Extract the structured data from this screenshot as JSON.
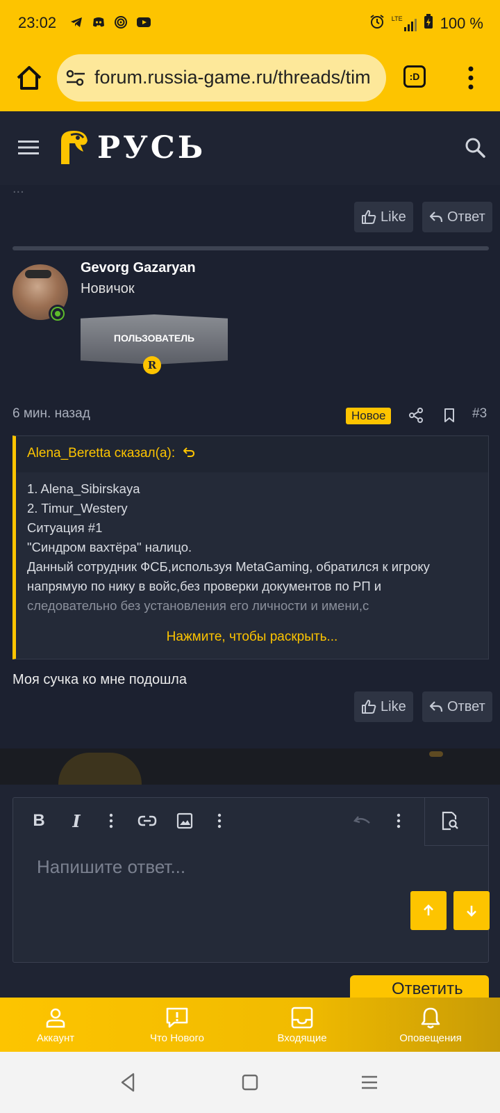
{
  "status_bar": {
    "time": "23:02",
    "network": "LTE",
    "battery": "100 %",
    "icons": [
      "telegram-icon",
      "discord-icon",
      "radio-icon",
      "youtube-icon",
      "alarm-icon",
      "signal-icon",
      "battery-icon"
    ]
  },
  "browser": {
    "url": "forum.russia-game.ru/threads/tim",
    "tabs_label": ":D",
    "icons": [
      "home-icon",
      "site-settings-icon",
      "more-vert-icon"
    ]
  },
  "site": {
    "logo_text": "РУСЬ",
    "icons": [
      "menu-icon",
      "search-icon"
    ]
  },
  "post_prev": {
    "fragment": "...",
    "like": "Like",
    "reply": "Ответ"
  },
  "post": {
    "author": "Gevorg Gazaryan",
    "user_title": "Новичок",
    "banner": "ПОЛЬЗОВАТЕЛЬ",
    "banner_emblem": "R",
    "time": "6 мин. назад",
    "badge": "Новое",
    "number": "#3",
    "quote": {
      "attribution": "Alena_Beretta сказал(а):",
      "lines": [
        "1. Alena_Sibirskaya",
        "2. Timur_Westery",
        "Ситуация #1",
        "\"Синдром вахтёра\" налицо.",
        "Данный сотрудник ФСБ,используя MetaGaming, обратился к игроку напрямую по нику в войс,без проверки документов по РП и",
        "следовательно без установления его личности и имени,с"
      ],
      "expand": "Нажмите, чтобы раскрыть..."
    },
    "body": "Моя сучка ко мне подошла",
    "like": "Like",
    "reply": "Ответ"
  },
  "editor": {
    "placeholder": "Напишите ответ...",
    "submit": "Ответить",
    "toolbar": [
      "bold-icon",
      "italic-icon",
      "more-vert-icon",
      "link-icon",
      "image-icon",
      "more-vert-icon",
      "undo-icon",
      "more-vert-icon",
      "preview-icon"
    ]
  },
  "bottom_nav": [
    {
      "label": "Аккаунт",
      "icon": "user-icon"
    },
    {
      "label": "Что Нового",
      "icon": "whats-new-icon"
    },
    {
      "label": "Входящие",
      "icon": "inbox-icon"
    },
    {
      "label": "Оповещения",
      "icon": "bell-icon"
    }
  ],
  "colors": {
    "accent": "#fdc400",
    "background": "#1c2130",
    "online": "#5dbb2b"
  }
}
